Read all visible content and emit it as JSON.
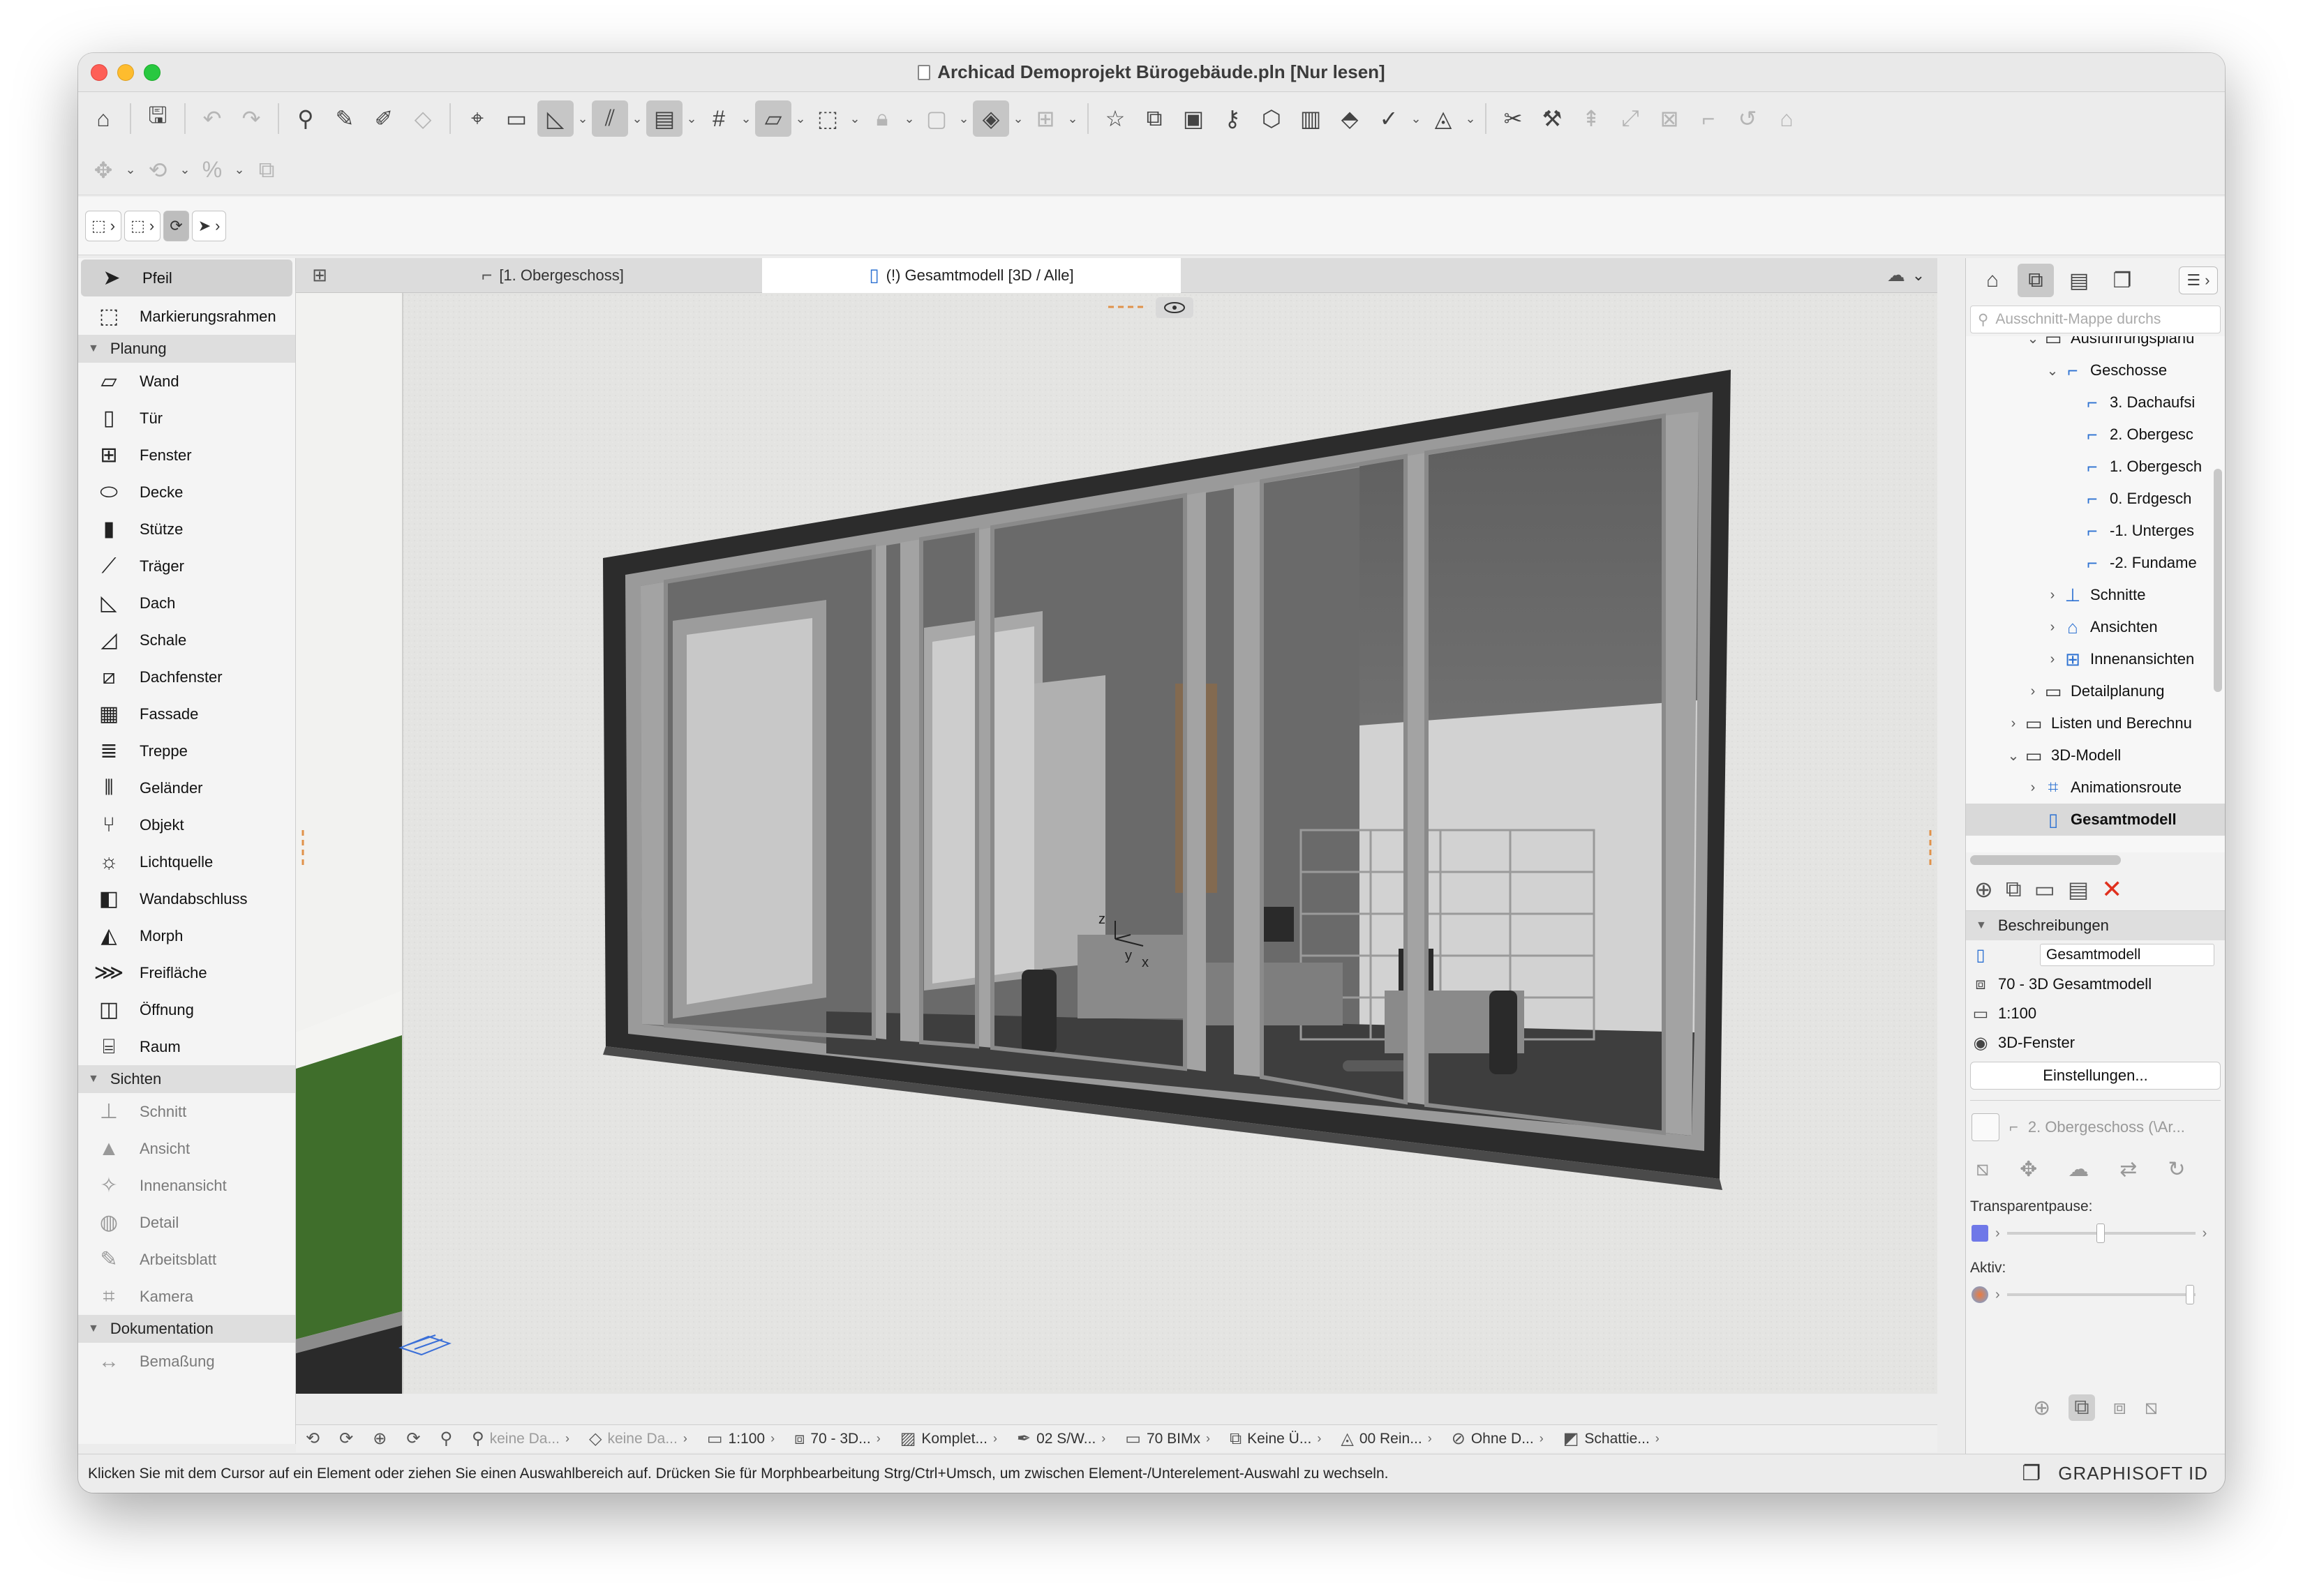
{
  "window": {
    "title": "Archicad Demoprojekt Bürogebäude.pln [Nur lesen]"
  },
  "toolbar2": {
    "arrow_tool_icon": "arrow-icon"
  },
  "toolbox": {
    "top": [
      {
        "label": "Pfeil",
        "icon": "arrow-icon",
        "selected": true
      },
      {
        "label": "Markierungsrahmen",
        "icon": "marquee-icon",
        "selected": false
      }
    ],
    "groups": [
      {
        "title": "Planung",
        "items": [
          {
            "label": "Wand",
            "icon": "wall-icon"
          },
          {
            "label": "Tür",
            "icon": "door-icon"
          },
          {
            "label": "Fenster",
            "icon": "window-icon"
          },
          {
            "label": "Decke",
            "icon": "slab-icon"
          },
          {
            "label": "Stütze",
            "icon": "column-icon"
          },
          {
            "label": "Träger",
            "icon": "beam-icon"
          },
          {
            "label": "Dach",
            "icon": "roof-icon"
          },
          {
            "label": "Schale",
            "icon": "shell-icon"
          },
          {
            "label": "Dachfenster",
            "icon": "skylight-icon"
          },
          {
            "label": "Fassade",
            "icon": "curtain-wall-icon"
          },
          {
            "label": "Treppe",
            "icon": "stair-icon"
          },
          {
            "label": "Geländer",
            "icon": "railing-icon"
          },
          {
            "label": "Objekt",
            "icon": "object-icon"
          },
          {
            "label": "Lichtquelle",
            "icon": "lamp-icon"
          },
          {
            "label": "Wandabschluss",
            "icon": "wall-end-icon"
          },
          {
            "label": "Morph",
            "icon": "morph-icon"
          },
          {
            "label": "Freifläche",
            "icon": "mesh-icon"
          },
          {
            "label": "Öffnung",
            "icon": "opening-icon"
          },
          {
            "label": "Raum",
            "icon": "zone-icon"
          }
        ]
      },
      {
        "title": "Sichten",
        "items": [
          {
            "label": "Schnitt",
            "icon": "section-icon"
          },
          {
            "label": "Ansicht",
            "icon": "elevation-icon"
          },
          {
            "label": "Innenansicht",
            "icon": "interior-elevation-icon"
          },
          {
            "label": "Detail",
            "icon": "detail-icon"
          },
          {
            "label": "Arbeitsblatt",
            "icon": "worksheet-icon"
          },
          {
            "label": "Kamera",
            "icon": "camera-icon"
          }
        ]
      },
      {
        "title": "Dokumentation",
        "items": [
          {
            "label": "Bemaßung",
            "icon": "dimension-icon"
          }
        ]
      }
    ]
  },
  "tabs": [
    {
      "label": "[1. Obergeschoss]",
      "icon": "floorplan-icon",
      "active": false
    },
    {
      "label": "(!) Gesamtmodell [3D / Alle]",
      "icon": "3d-view-icon",
      "active": true
    }
  ],
  "viewport": {
    "axis_labels": {
      "z": "z",
      "y": "y",
      "x": "x"
    },
    "colors": {
      "wall": "#dcdcdc",
      "frame": "#8f8f8f",
      "glass": "#6b6b6b",
      "lawn": "#3d6b2a"
    }
  },
  "quickbar": {
    "items": [
      {
        "label": "keine Da...",
        "icon": "layer-icon",
        "dim": true
      },
      {
        "label": "keine Da...",
        "icon": "layer-icon",
        "dim": true
      },
      {
        "label": "1:100",
        "icon": "scale-icon",
        "dim": false
      },
      {
        "label": "70 - 3D...",
        "icon": "layer-combination-icon",
        "dim": false
      },
      {
        "label": "Komplet...",
        "icon": "structure-icon",
        "dim": false
      },
      {
        "label": "02 S/W...",
        "icon": "pen-set-icon",
        "dim": false
      },
      {
        "label": "70 BIMx",
        "icon": "model-view-icon",
        "dim": false
      },
      {
        "label": "Keine Ü...",
        "icon": "override-icon",
        "dim": false
      },
      {
        "label": "00 Rein...",
        "icon": "renovation-icon",
        "dim": false
      },
      {
        "label": "Ohne D...",
        "icon": "design-option-icon",
        "dim": false
      },
      {
        "label": "Schattie...",
        "icon": "3d-style-icon",
        "dim": false
      }
    ]
  },
  "status": {
    "text": "Klicken Sie mit dem Cursor auf ein Element oder ziehen Sie einen Auswahlbereich auf. Drücken Sie für Morphbearbeitung Strg/Ctrl+Umsch, um zwischen Element-/Unterelement-Auswahl zu wechseln.",
    "brand": "GRAPHISOFT ID"
  },
  "navigator": {
    "search_placeholder": "Ausschnitt-Mappe durchs",
    "tree": [
      {
        "label": "Ausführungsplanu",
        "indent": 2,
        "chevron": "⌄",
        "icon": "folder-icon"
      },
      {
        "label": "Geschosse",
        "indent": 3,
        "chevron": "⌄",
        "icon": "stories-icon"
      },
      {
        "label": "3. Dachaufsi",
        "indent": 4,
        "chevron": "",
        "icon": "story-icon"
      },
      {
        "label": "2. Obergesc",
        "indent": 4,
        "chevron": "",
        "icon": "story-icon"
      },
      {
        "label": "1. Obergesch",
        "indent": 4,
        "chevron": "",
        "icon": "story-icon"
      },
      {
        "label": "0. Erdgesch",
        "indent": 4,
        "chevron": "",
        "icon": "story-icon"
      },
      {
        "label": "-1. Unterges",
        "indent": 4,
        "chevron": "",
        "icon": "story-icon"
      },
      {
        "label": "-2. Fundame",
        "indent": 4,
        "chevron": "",
        "icon": "story-icon"
      },
      {
        "label": "Schnitte",
        "indent": 3,
        "chevron": "›",
        "icon": "sections-icon"
      },
      {
        "label": "Ansichten",
        "indent": 3,
        "chevron": "›",
        "icon": "elevations-icon"
      },
      {
        "label": "Innenansichten",
        "indent": 3,
        "chevron": "›",
        "icon": "interior-elevations-icon"
      },
      {
        "label": "Detailplanung",
        "indent": 2,
        "chevron": "›",
        "icon": "folder-icon"
      },
      {
        "label": "Listen und Berechnu",
        "indent": 1,
        "chevron": "›",
        "icon": "folder-icon"
      },
      {
        "label": "3D-Modell",
        "indent": 1,
        "chevron": "⌄",
        "icon": "folder-icon"
      },
      {
        "label": "Animationsroute",
        "indent": 2,
        "chevron": "›",
        "icon": "camera-path-icon"
      },
      {
        "label": "Gesamtmodell",
        "indent": 2,
        "chevron": "",
        "icon": "3d-view-icon",
        "selected": true
      }
    ],
    "properties": {
      "section_title": "Beschreibungen",
      "name_value": "Gesamtmodell",
      "layer_combination": "70 - 3D Gesamtmodell",
      "scale": "1:100",
      "mode": "3D-Fenster",
      "settings_button": "Einstellungen...",
      "linked_view": "2. Obergeschoss (\\Ar...",
      "transparent_label": "Transparentpause:",
      "active_label": "Aktiv:"
    }
  }
}
